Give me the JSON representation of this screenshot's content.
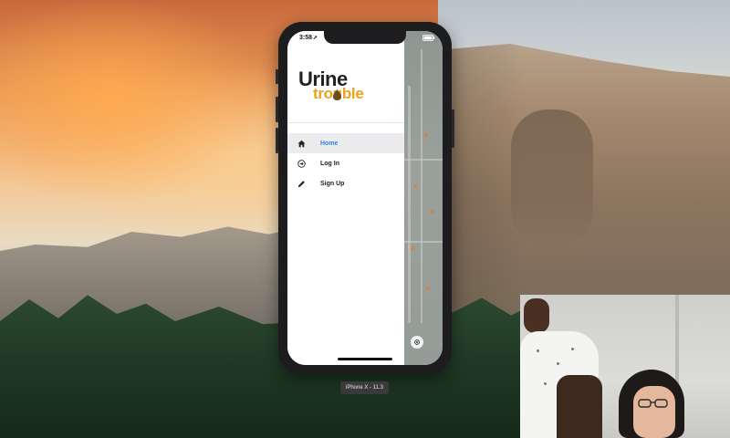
{
  "device_screen": {
    "status_bar": {
      "time": "3:58"
    },
    "logo": {
      "word1": "Urine",
      "word2": "trouble"
    },
    "menu": {
      "items": [
        {
          "label": "Home",
          "icon": "home-icon",
          "active": true
        },
        {
          "label": "Log In",
          "icon": "login-icon",
          "active": false
        },
        {
          "label": "Sign Up",
          "icon": "pencil-icon",
          "active": false
        }
      ]
    }
  },
  "simulator": {
    "label": "iPhone X - 11.3"
  },
  "colors": {
    "active_menu_text": "#2f80ed",
    "logo_dark": "#231f20",
    "logo_accent": "#e8a21c"
  }
}
